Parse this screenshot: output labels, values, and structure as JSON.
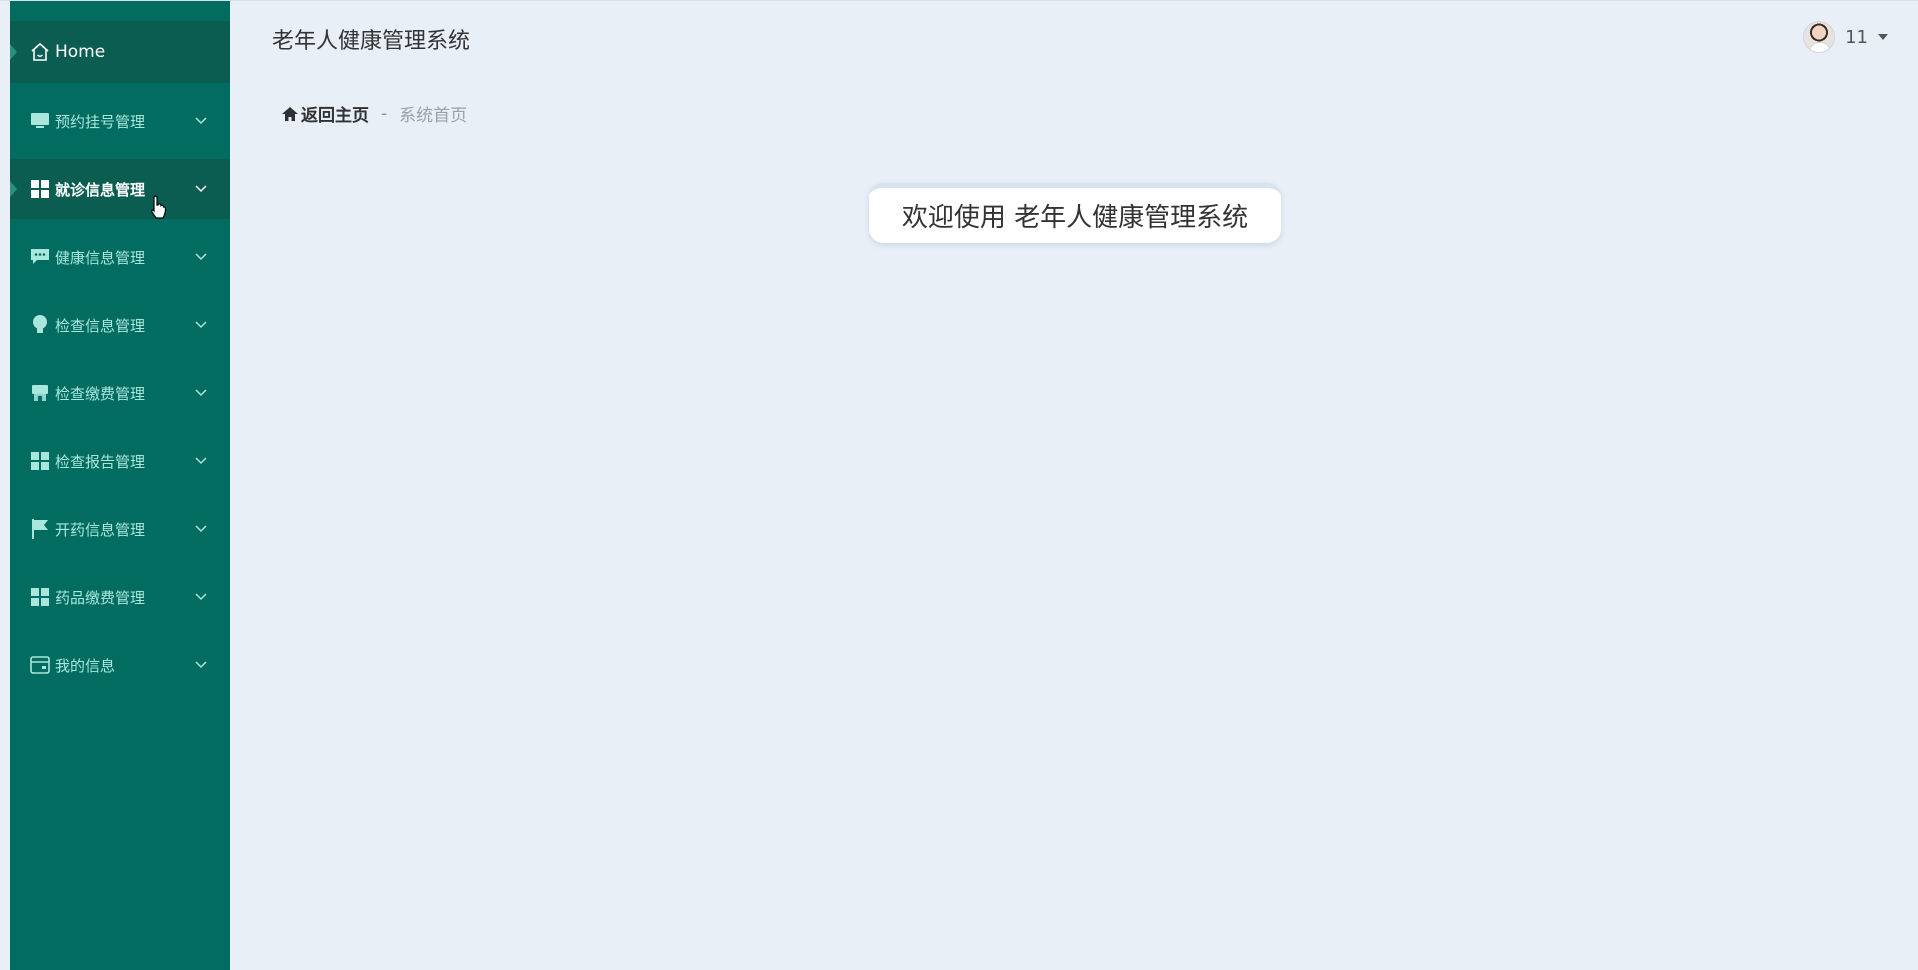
{
  "app": {
    "title": "老年人健康管理系统"
  },
  "user": {
    "name": "11"
  },
  "breadcrumb": {
    "home": "返回主页",
    "separator": "-",
    "current": "系统首页"
  },
  "welcome": {
    "text": "欢迎使用 老年人健康管理系统"
  },
  "sidebar": {
    "home": {
      "label": "Home",
      "icon": "home-icon"
    },
    "items": [
      {
        "label": "预约挂号管理",
        "icon": "monitor-icon"
      },
      {
        "label": "就诊信息管理",
        "icon": "grid-icon",
        "active": true
      },
      {
        "label": "健康信息管理",
        "icon": "chat-icon"
      },
      {
        "label": "检查信息管理",
        "icon": "bulb-icon"
      },
      {
        "label": "检查缴费管理",
        "icon": "shop-icon"
      },
      {
        "label": "检查报告管理",
        "icon": "grid-icon"
      },
      {
        "label": "开药信息管理",
        "icon": "flag-icon"
      },
      {
        "label": "药品缴费管理",
        "icon": "grid-icon"
      },
      {
        "label": "我的信息",
        "icon": "card-icon"
      }
    ]
  },
  "colors": {
    "sidebar_bg": "#036c61",
    "sidebar_active": "#0b5c51",
    "page_bg": "#e8eff7",
    "menu_text": "#a9e6dc"
  }
}
